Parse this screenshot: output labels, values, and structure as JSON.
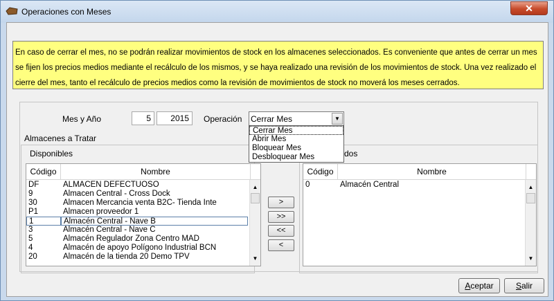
{
  "window": {
    "title": "Operaciones con Meses",
    "close_label": "✕"
  },
  "info_text": "En caso de cerrar el mes, no se podrán realizar movimientos de stock en los almacenes seleccionados. Es conveniente que antes de cerrar un mes se fijen los precios medios mediante el recálculo de los mismos, y se haya realizado una revisión de los movimientos de stock. Una vez realizado el cierre del mes, tanto el recálculo de precios medios como la revisión de movimientos de stock no moverá los meses cerrados.",
  "form": {
    "mes_label": "Mes y Año",
    "mes_value": "5",
    "anio_value": "2015",
    "operacion_label": "Operación",
    "operacion_value": "Cerrar Mes",
    "options": [
      "Cerrar Mes",
      "Abrir Mes",
      "Bloquear Mes",
      "Desbloquear Mes"
    ]
  },
  "almacenes_label": "Almacenes a Tratar",
  "disponibles": {
    "label": "Disponibles",
    "headers": [
      "Código",
      "Nombre"
    ],
    "rows": [
      [
        "DF",
        "ALMACEN DEFECTUOSO"
      ],
      [
        "9",
        "Almacen Central - Cross Dock"
      ],
      [
        "30",
        "Almacen Mercancia venta B2C- Tienda Inte"
      ],
      [
        "P1",
        "Almacen proveedor 1"
      ],
      [
        "1",
        "Almacén Central - Nave B"
      ],
      [
        "3",
        "Almacén Central - Nave C"
      ],
      [
        "5",
        "Almacén Regulador Zona Centro MAD"
      ],
      [
        "4",
        "Almacén de apoyo Polígono Industrial BCN"
      ],
      [
        "20",
        "Almacén de la tienda 20 Demo TPV"
      ]
    ]
  },
  "seleccionados": {
    "label": "dos",
    "headers": [
      "Código",
      "Nombre"
    ],
    "rows": [
      [
        "0",
        "Almacén Central"
      ]
    ]
  },
  "move_buttons": [
    ">",
    ">>",
    "<<",
    "<"
  ],
  "buttons": {
    "aceptar": "Aceptar",
    "salir": "Salir"
  }
}
